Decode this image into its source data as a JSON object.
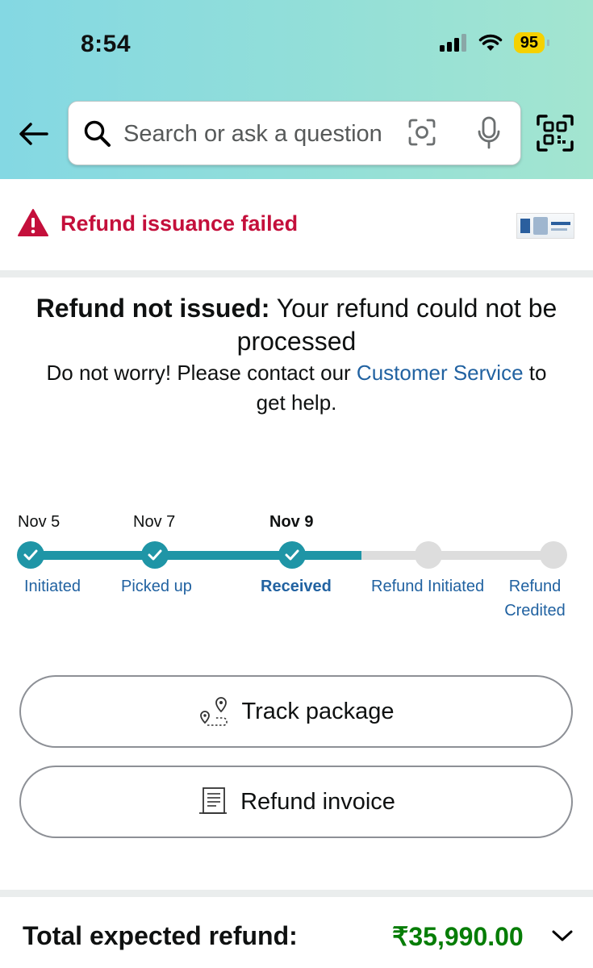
{
  "status_bar": {
    "time": "8:54",
    "battery": "95"
  },
  "search": {
    "placeholder": "Search or ask a question"
  },
  "alert": {
    "text": "Refund issuance failed"
  },
  "message": {
    "heading_bold": "Refund not issued:",
    "heading_rest": " Your refund could not be processed",
    "sub_before": "Do not worry! Please contact our ",
    "sub_link": "Customer Service",
    "sub_after": " to get help."
  },
  "timeline": {
    "dates": [
      "Nov 5",
      "Nov 7",
      "Nov 9"
    ],
    "steps": [
      "Initiated",
      "Picked up",
      "Received",
      "Refund Initiated",
      "Refund Credited"
    ],
    "completed_steps": 3
  },
  "buttons": {
    "track": "Track package",
    "invoice": "Refund invoice"
  },
  "total": {
    "label": "Total expected refund:",
    "amount": "₹35,990.00"
  },
  "colors": {
    "accent": "#1f95a6",
    "alert": "#c40f3b",
    "link": "#2162a1",
    "amount": "#067d06"
  }
}
